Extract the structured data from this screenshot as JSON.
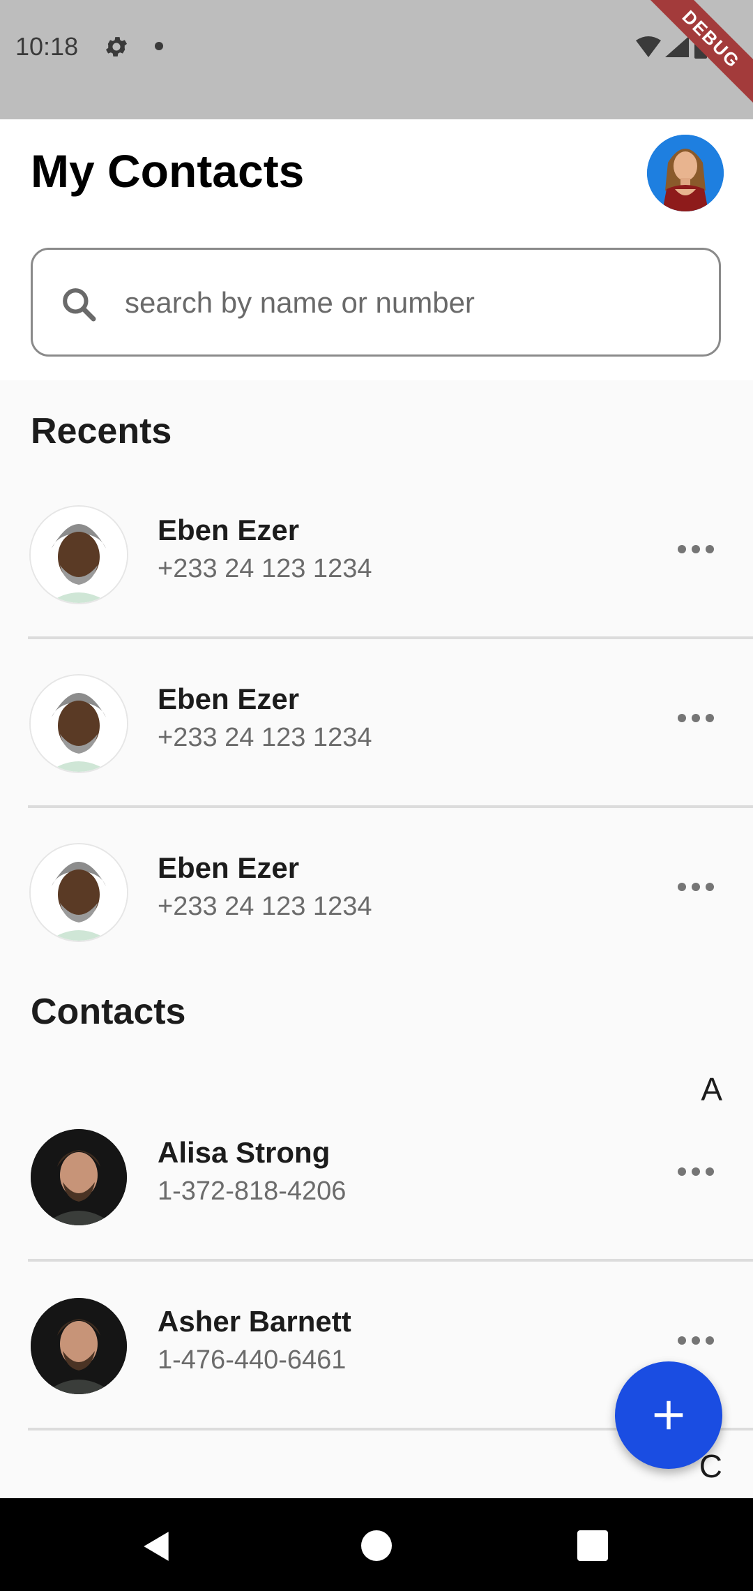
{
  "status_bar": {
    "time": "10:18",
    "debug_label": "DEBUG"
  },
  "header": {
    "title": "My Contacts",
    "search_placeholder": "search by name or number",
    "search_value": ""
  },
  "recents": {
    "title": "Recents",
    "items": [
      {
        "name": "Eben Ezer",
        "phone": "+233 24 123 1234"
      },
      {
        "name": "Eben Ezer",
        "phone": "+233 24 123 1234"
      },
      {
        "name": "Eben Ezer",
        "phone": "+233 24 123 1234"
      }
    ]
  },
  "contacts": {
    "title": "Contacts",
    "groups": [
      {
        "letter": "A",
        "items": [
          {
            "name": "Alisa Strong",
            "phone": "1-372-818-4206"
          },
          {
            "name": "Asher Barnett",
            "phone": "1-476-440-6461"
          }
        ]
      },
      {
        "letter": "C",
        "items": []
      }
    ]
  },
  "colors": {
    "accent": "#1a4de2",
    "status_bar": "#bdbdbd",
    "debug_banner": "#a33b3b"
  },
  "icons": {
    "status": [
      "gear-icon",
      "dot-icon",
      "wifi-icon",
      "signal-icon",
      "battery-icon"
    ],
    "search": "search-icon",
    "row_action": "more-horizontal-icon",
    "fab": "plus-icon",
    "nav": [
      "back-icon",
      "home-icon",
      "recents-icon"
    ]
  }
}
